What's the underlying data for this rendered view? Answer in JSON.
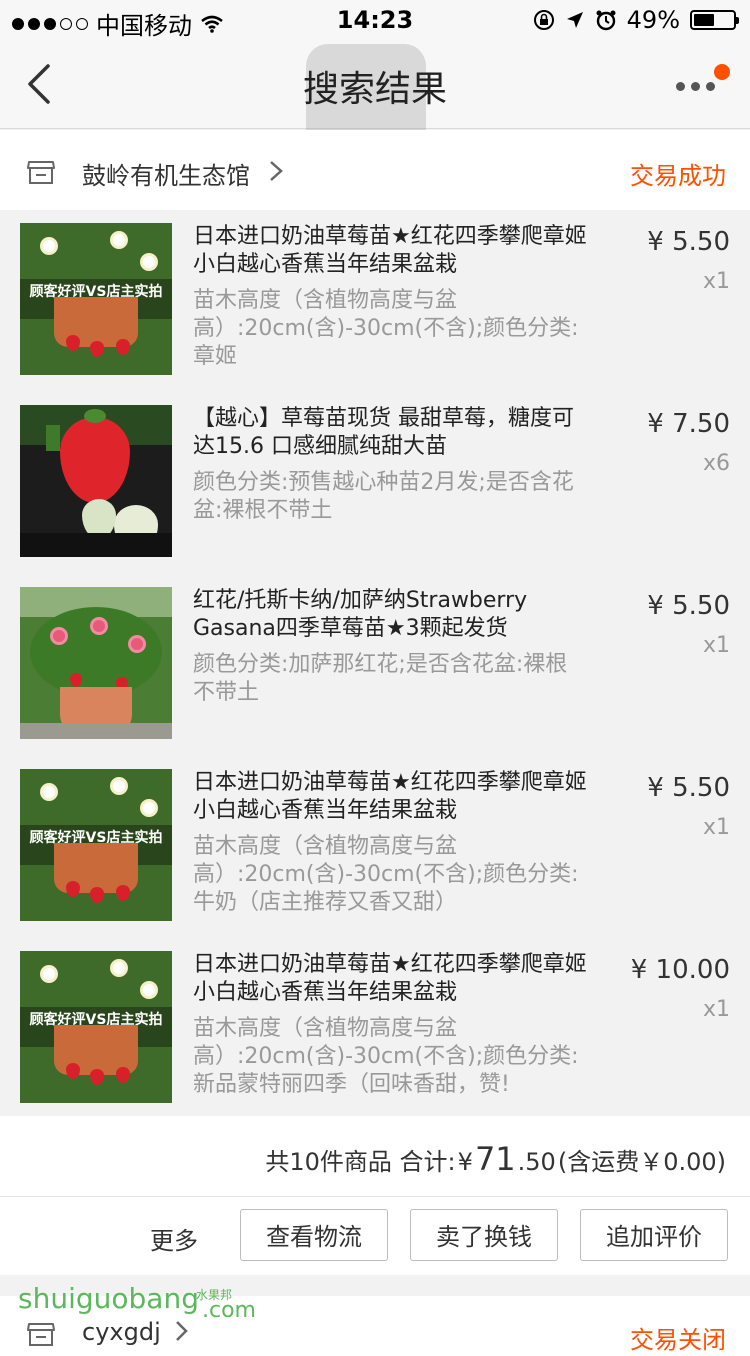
{
  "status_bar": {
    "carrier": "中国移动",
    "time": "14:23",
    "battery": "49%",
    "battery_level": 0.49
  },
  "nav": {
    "title": "搜索结果",
    "back_icon": "chevron-left-icon",
    "more_icon": "more-dots-icon"
  },
  "shop": {
    "name": "鼓岭有机生态馆",
    "status": "交易成功"
  },
  "items": [
    {
      "title": "日本进口奶油草莓苗★红花四季攀爬章姬小白越心香蕉当年结果盆栽",
      "spec": "苗木高度（含植物高度与盆高）:20cm(含)-30cm(不含);颜色分类:章姬",
      "price": "¥ 5.50",
      "qty": "x1",
      "img_label": "顾客好评VS店主实拍",
      "img_sub": "鼓岭有机生态馆"
    },
    {
      "title": "【越心】草莓苗现货  最甜草莓，糖度可达15.6  口感细腻纯甜大苗",
      "spec": "颜色分类:预售越心种苗2月发;是否含花盆:裸根不带土",
      "price": "¥ 7.50",
      "qty": "x6"
    },
    {
      "title": "红花/托斯卡纳/加萨纳Strawberry Gasana四季草莓苗★3颗起发货",
      "spec": "颜色分类:加萨那红花;是否含花盆:裸根不带土",
      "price": "¥ 5.50",
      "qty": "x1"
    },
    {
      "title": "日本进口奶油草莓苗★红花四季攀爬章姬小白越心香蕉当年结果盆栽",
      "spec": "苗木高度（含植物高度与盆高）:20cm(含)-30cm(不含);颜色分类:牛奶（店主推荐又香又甜）",
      "price": "¥ 5.50",
      "qty": "x1",
      "img_label": "顾客好评VS店主实拍",
      "img_sub": "鼓岭有机生态馆"
    },
    {
      "title": "日本进口奶油草莓苗★红花四季攀爬章姬小白越心香蕉当年结果盆栽",
      "spec": "苗木高度（含植物高度与盆高）:20cm(含)-30cm(不含);颜色分类:新品蒙特丽四季（回味香甜，赞!",
      "price": "¥ 10.00",
      "qty": "x1",
      "img_label": "顾客好评VS店主实拍",
      "img_sub": "鼓岭有机生态馆"
    }
  ],
  "summary": {
    "count_text": "共10件商品 合计:",
    "currency": "¥",
    "total_int": "71",
    "total_dec": ".50",
    "shipping": "(含运费￥0.00)"
  },
  "actions": {
    "more": "更多",
    "logistics": "查看物流",
    "resell": "卖了换钱",
    "review": "追加评价"
  },
  "next_order": {
    "shop_name": "cyxgdj",
    "status": "交易关闭"
  },
  "watermark": {
    "text": "shuiguobang",
    "sub": "水果邦",
    "com": ".com"
  },
  "colors": {
    "accent": "#ff5000",
    "watermark": "#5cb85c"
  }
}
